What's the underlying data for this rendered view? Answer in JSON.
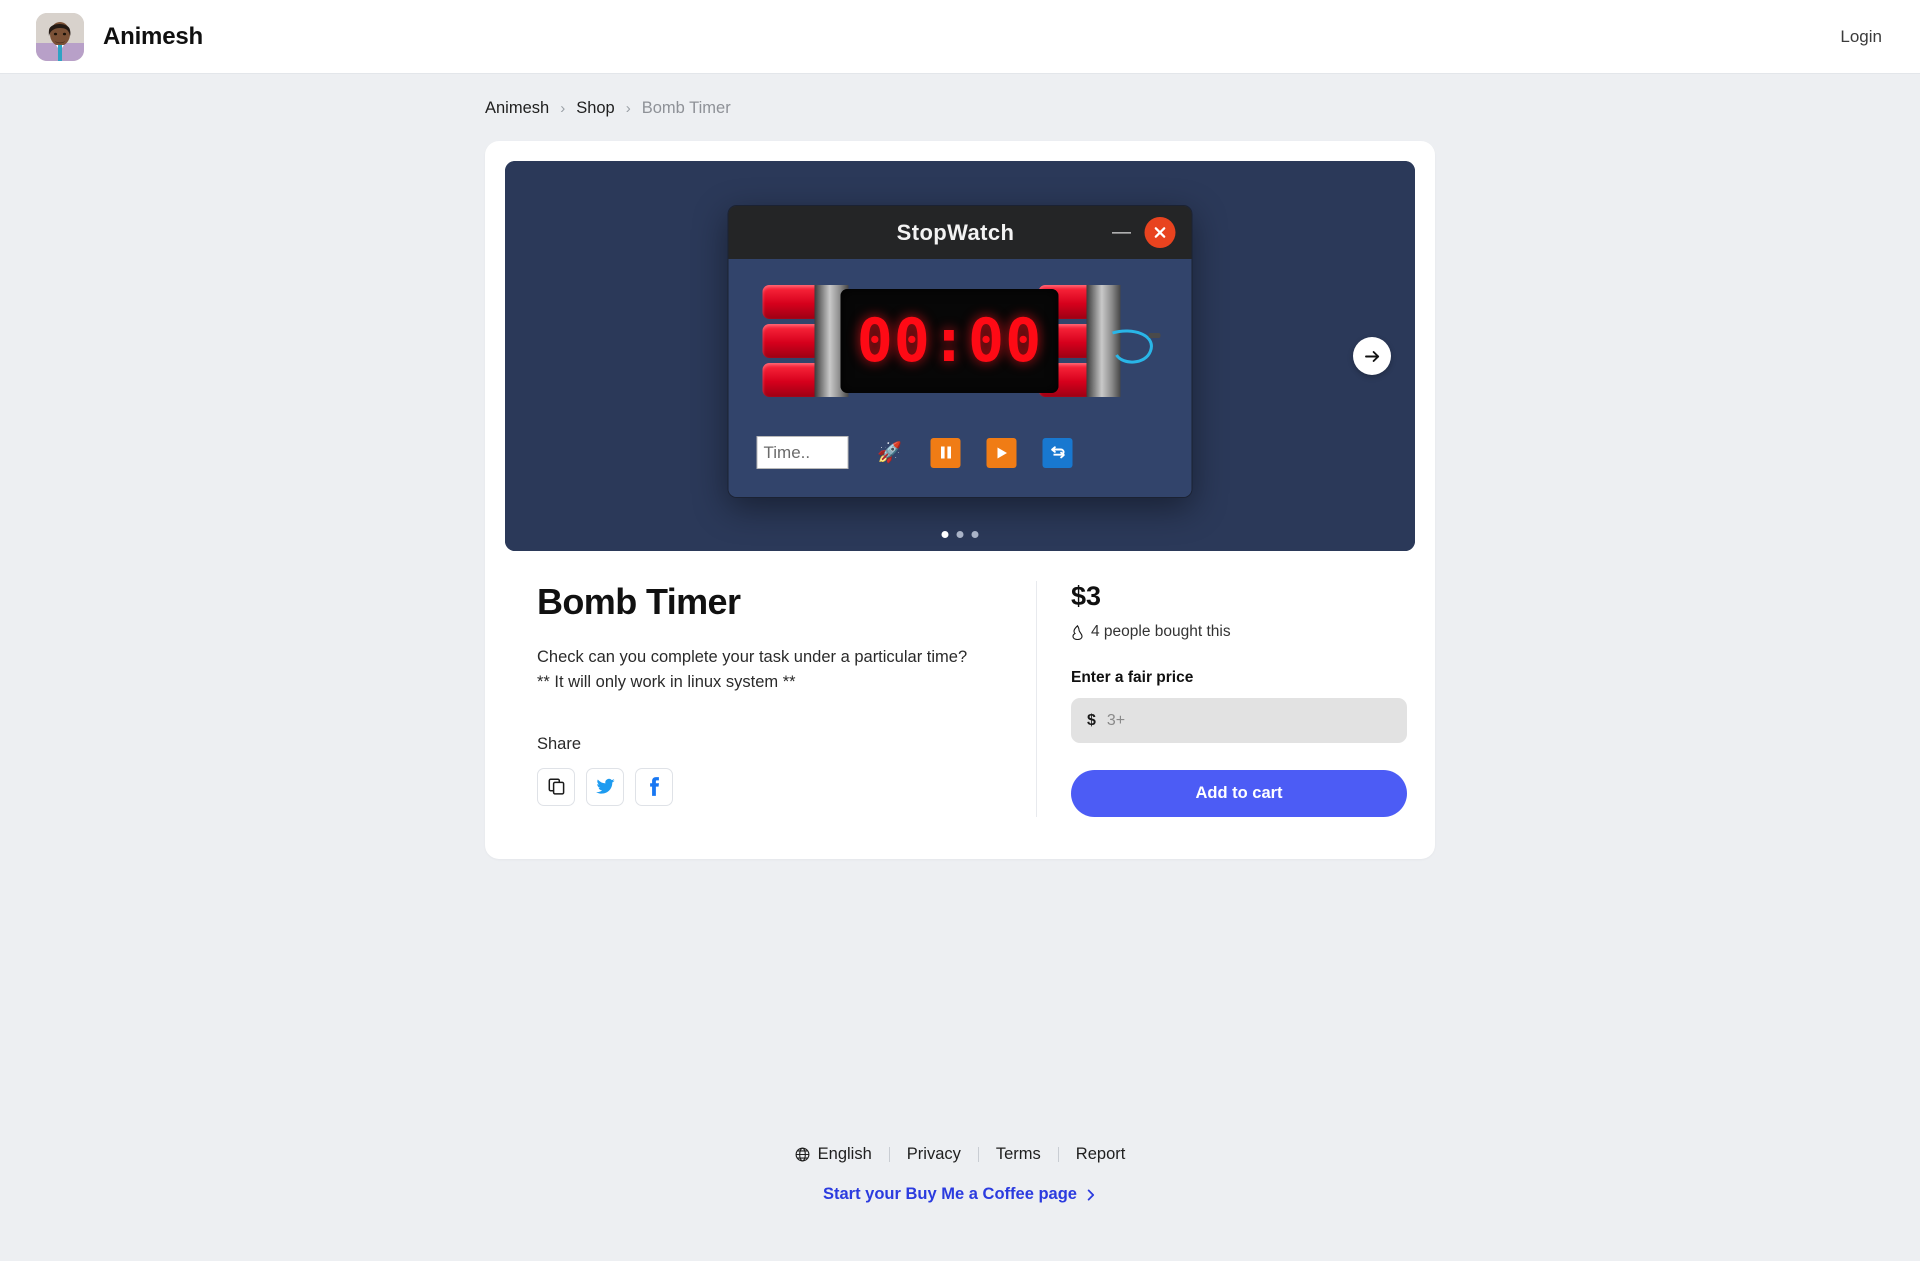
{
  "header": {
    "brand_name": "Animesh",
    "login_label": "Login",
    "avatar_icon": "user-avatar-photo"
  },
  "breadcrumb": {
    "items": [
      {
        "label": "Animesh",
        "current": false
      },
      {
        "label": "Shop",
        "current": false
      },
      {
        "label": "Bomb Timer",
        "current": true
      }
    ],
    "separator": "›"
  },
  "carousel": {
    "next_icon": "arrow-right-icon",
    "dots_total": 3,
    "active_dot": 1,
    "slide": {
      "app_title": "StopWatch",
      "minimize_icon": "minimize-icon",
      "close_icon": "close-icon",
      "display_value": "00:00",
      "time_input_placeholder": "Time..",
      "controls": [
        {
          "name": "launch-button",
          "icon": "rocket-icon",
          "glyph": "🚀",
          "style": "plain"
        },
        {
          "name": "pause-button",
          "icon": "pause-icon",
          "glyph": "⎉",
          "style": "orange"
        },
        {
          "name": "play-button",
          "icon": "play-icon",
          "glyph": "▶",
          "style": "orange"
        },
        {
          "name": "reset-button",
          "icon": "reset-icon",
          "glyph": "↻",
          "style": "blue"
        }
      ]
    }
  },
  "product": {
    "title": "Bomb Timer",
    "description_line_1": "Check can you complete your task under a particular time?",
    "description_line_2": "** It will only work in linux system **",
    "share_label": "Share",
    "share_buttons": [
      {
        "name": "copy-link-button",
        "icon": "copy-icon"
      },
      {
        "name": "share-twitter-button",
        "icon": "twitter-icon"
      },
      {
        "name": "share-facebook-button",
        "icon": "facebook-icon"
      }
    ]
  },
  "purchase": {
    "price": "$3",
    "bought_icon": "flame-icon",
    "bought_text": "4 people bought this",
    "fair_price_label": "Enter a fair price",
    "currency_symbol": "$",
    "price_placeholder": "3+",
    "price_value": "",
    "add_to_cart_label": "Add to cart"
  },
  "footer": {
    "language_icon": "globe-icon",
    "language": "English",
    "links": [
      "Privacy",
      "Terms",
      "Report"
    ],
    "cta": "Start your Buy Me a Coffee page",
    "cta_icon": "chevron-right-icon"
  },
  "colors": {
    "accent": "#4c5cf5",
    "cta_link": "#2b3bdf",
    "page_bg": "#edeff2",
    "card_bg": "#ffffff",
    "slide_bg": "#2b3959",
    "lcd_red": "#fe0a15",
    "close_red": "#e8431f",
    "twitter_blue": "#1d9bf0",
    "facebook_blue": "#1877f2"
  }
}
